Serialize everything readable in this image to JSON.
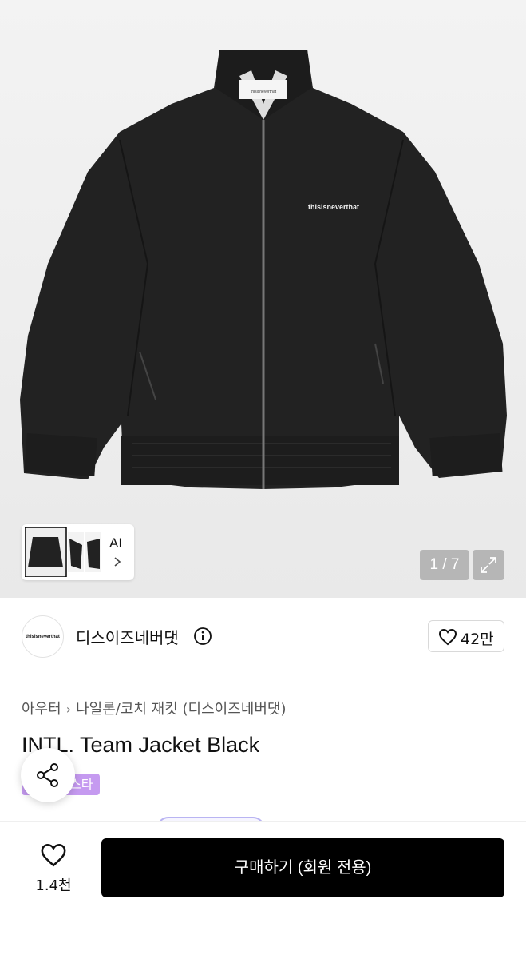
{
  "gallery": {
    "counter": "1 / 7",
    "ai_label": "AI",
    "jacket_chest_logo": "thisisneverthat",
    "jacket_label": "thisisneverthat"
  },
  "brand": {
    "logo_text": "thisisneverthat",
    "name": "디스이즈네버댓",
    "like_count": "42만"
  },
  "product": {
    "breadcrumb": [
      "아우터",
      "나일론/코치 재킷 (디스이즈네버댓)"
    ],
    "title": "INTL. Team Jacket Black",
    "tag": "스타"
  },
  "bottom_bar": {
    "wish_count": "1.4천",
    "buy_label": "구매하기 (회원 전용)"
  },
  "icons": {
    "expand": "expand-icon",
    "info": "info-icon",
    "heart": "heart-icon",
    "share": "share-icon",
    "chevron": "chevron-right-icon"
  },
  "colors": {
    "tag_bg": "#c59af0",
    "buy_bg": "#000000",
    "jacket": "#222222"
  }
}
